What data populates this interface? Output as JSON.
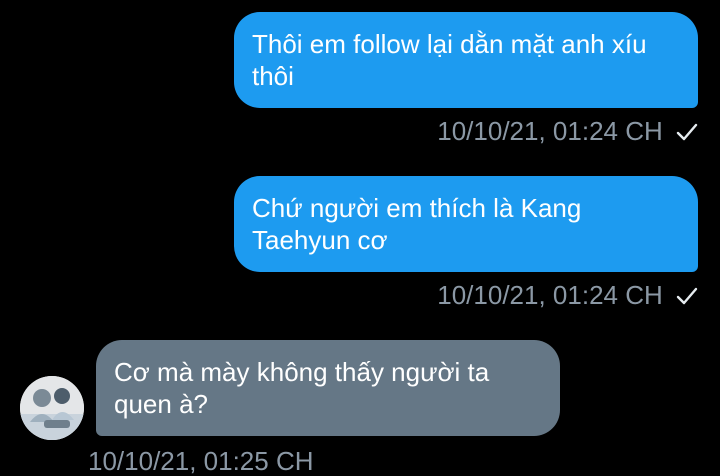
{
  "colors": {
    "background": "#000000",
    "outgoing_bubble": "#1d9bf0",
    "incoming_bubble": "#657786",
    "meta_text": "#8b98a5"
  },
  "messages": [
    {
      "direction": "outgoing",
      "lines": [
        "Thôi em follow lại dằn mặt anh xíu",
        "thôi"
      ],
      "timestamp": "10/10/21, 01:24 CH",
      "status_icon": "check-icon"
    },
    {
      "direction": "outgoing",
      "lines": [
        "Chứ người em thích là Kang",
        "Taehyun cơ"
      ],
      "timestamp": "10/10/21, 01:24 CH",
      "status_icon": "check-icon"
    },
    {
      "direction": "incoming",
      "lines": [
        "Cơ mà mày không thấy người ta",
        "quen à?"
      ],
      "timestamp": "10/10/21, 01:25 CH",
      "avatar_icon": "user-avatar"
    }
  ]
}
